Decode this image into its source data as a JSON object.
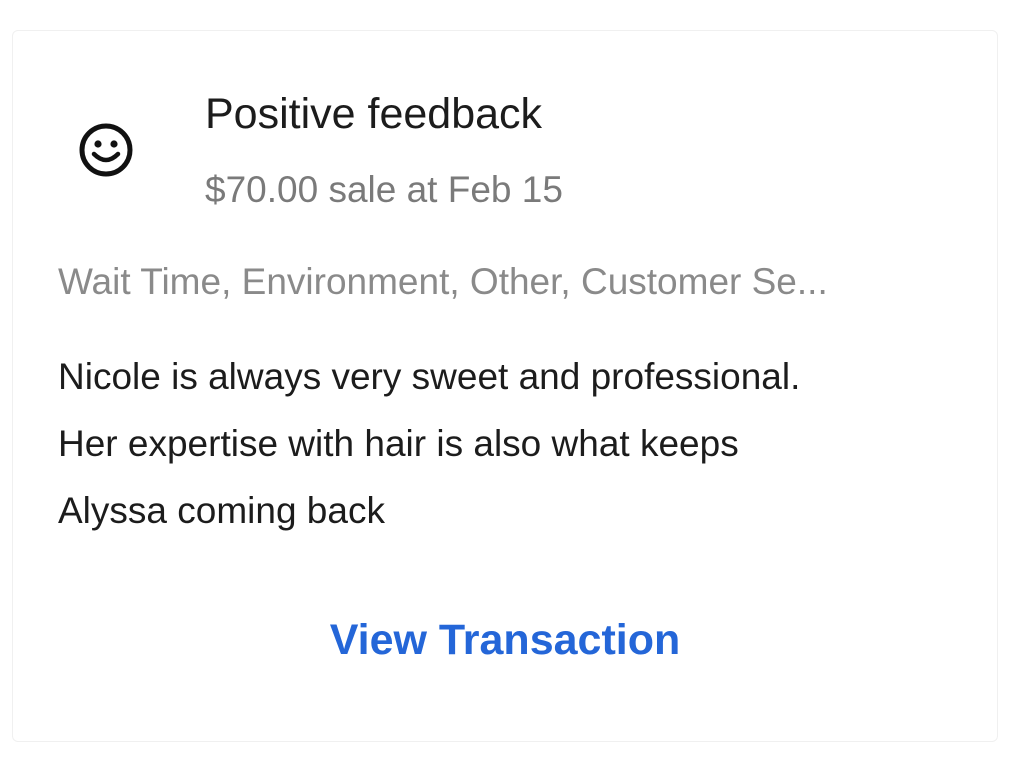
{
  "feedback": {
    "icon": "smiley-face-icon",
    "title": "Positive feedback",
    "subtitle": "$70.00 sale at Feb 15",
    "tags": "Wait Time, Environment, Other, Customer Se...",
    "comment_lines": [
      "Nicole is always very sweet and professional.",
      "Her expertise with hair is also what keeps",
      "Alyssa coming back"
    ],
    "action_label": "View Transaction"
  },
  "colors": {
    "title": "#1c1c1c",
    "muted": "#7a7a7a",
    "link": "#2466d8"
  }
}
